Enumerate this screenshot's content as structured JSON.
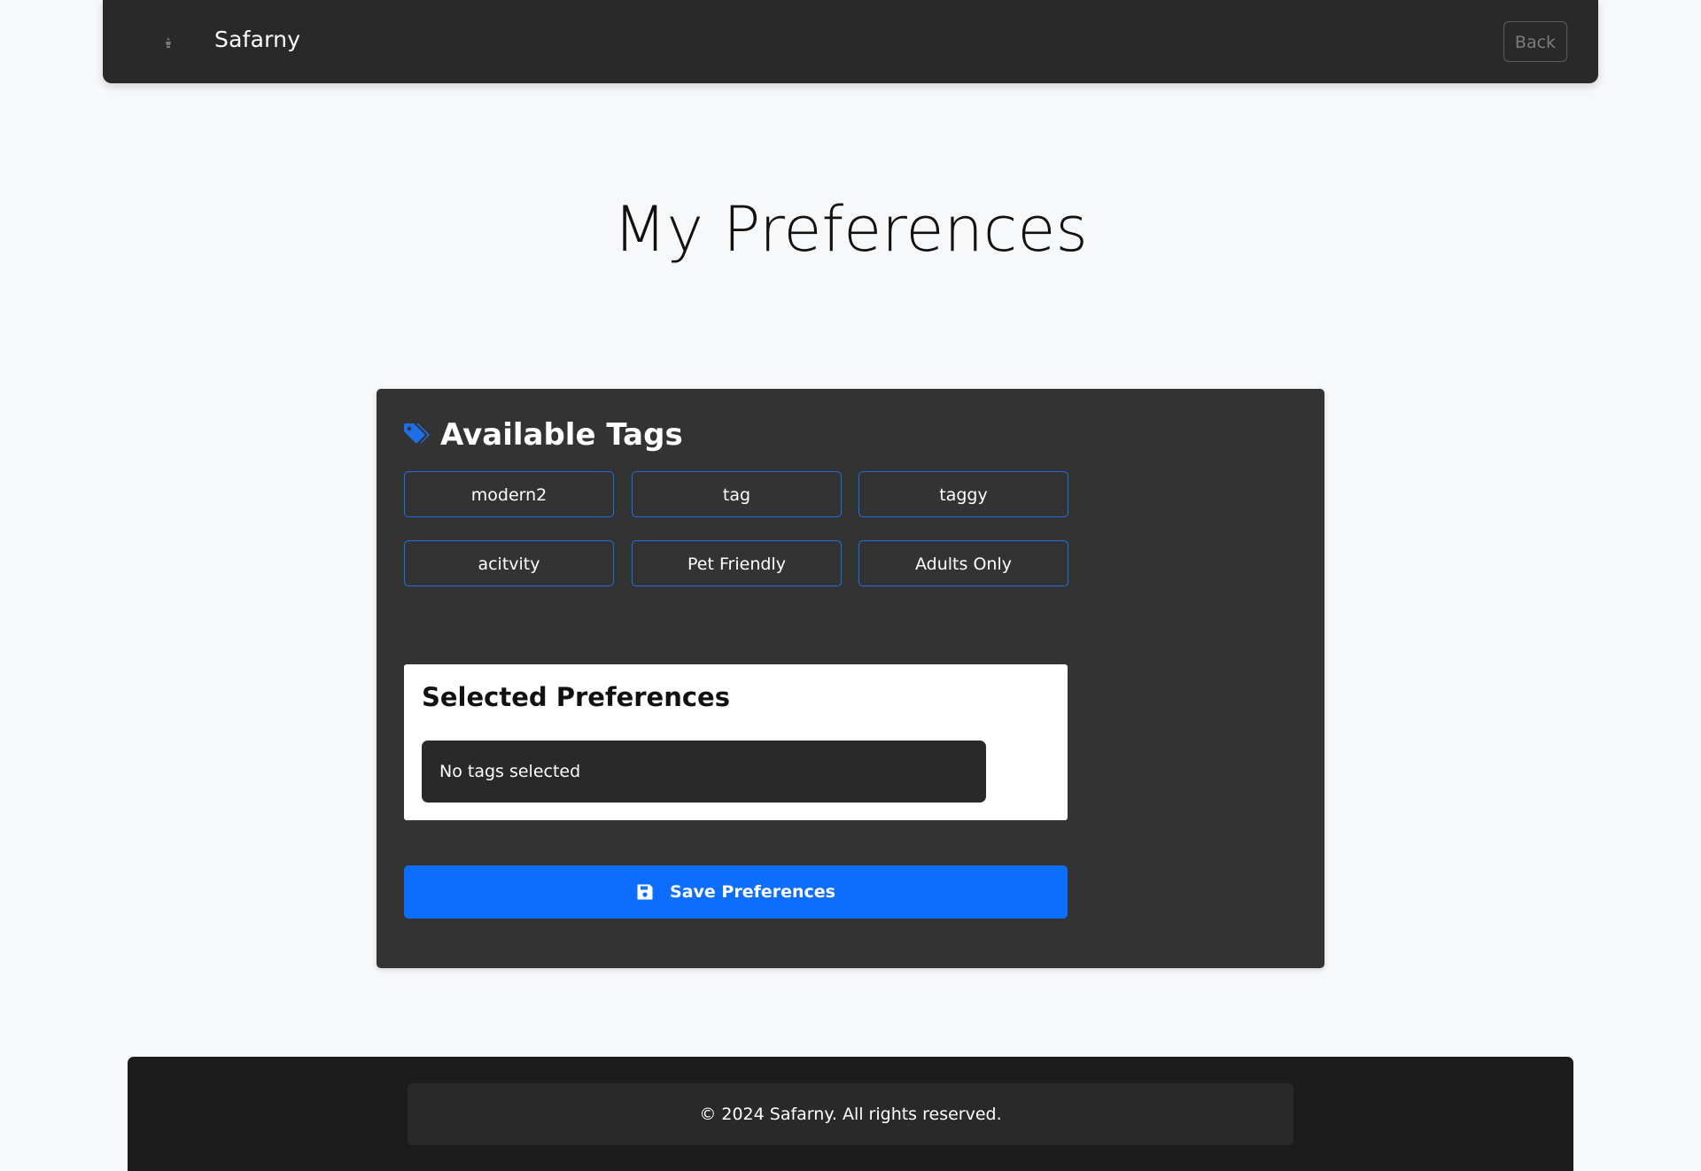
{
  "navbar": {
    "brand_name": "Safarny",
    "back_label": "Back"
  },
  "page": {
    "title": "My Preferences"
  },
  "tags_section": {
    "title": "Available Tags",
    "tags": [
      {
        "label": "modern2"
      },
      {
        "label": "tag"
      },
      {
        "label": "taggy"
      },
      {
        "label": "acitvity"
      },
      {
        "label": "Pet Friendly"
      },
      {
        "label": "Adults Only"
      }
    ]
  },
  "selected_section": {
    "title": "Selected Preferences",
    "empty_message": "No tags selected"
  },
  "save_button": {
    "label": "Save Preferences"
  },
  "footer": {
    "text": "© 2024 Safarny. All rights reserved."
  },
  "colors": {
    "primary": "#0d6efd",
    "navbar_bg": "#292929",
    "card_bg": "#333333",
    "footer_bg": "#1c1c1c"
  }
}
